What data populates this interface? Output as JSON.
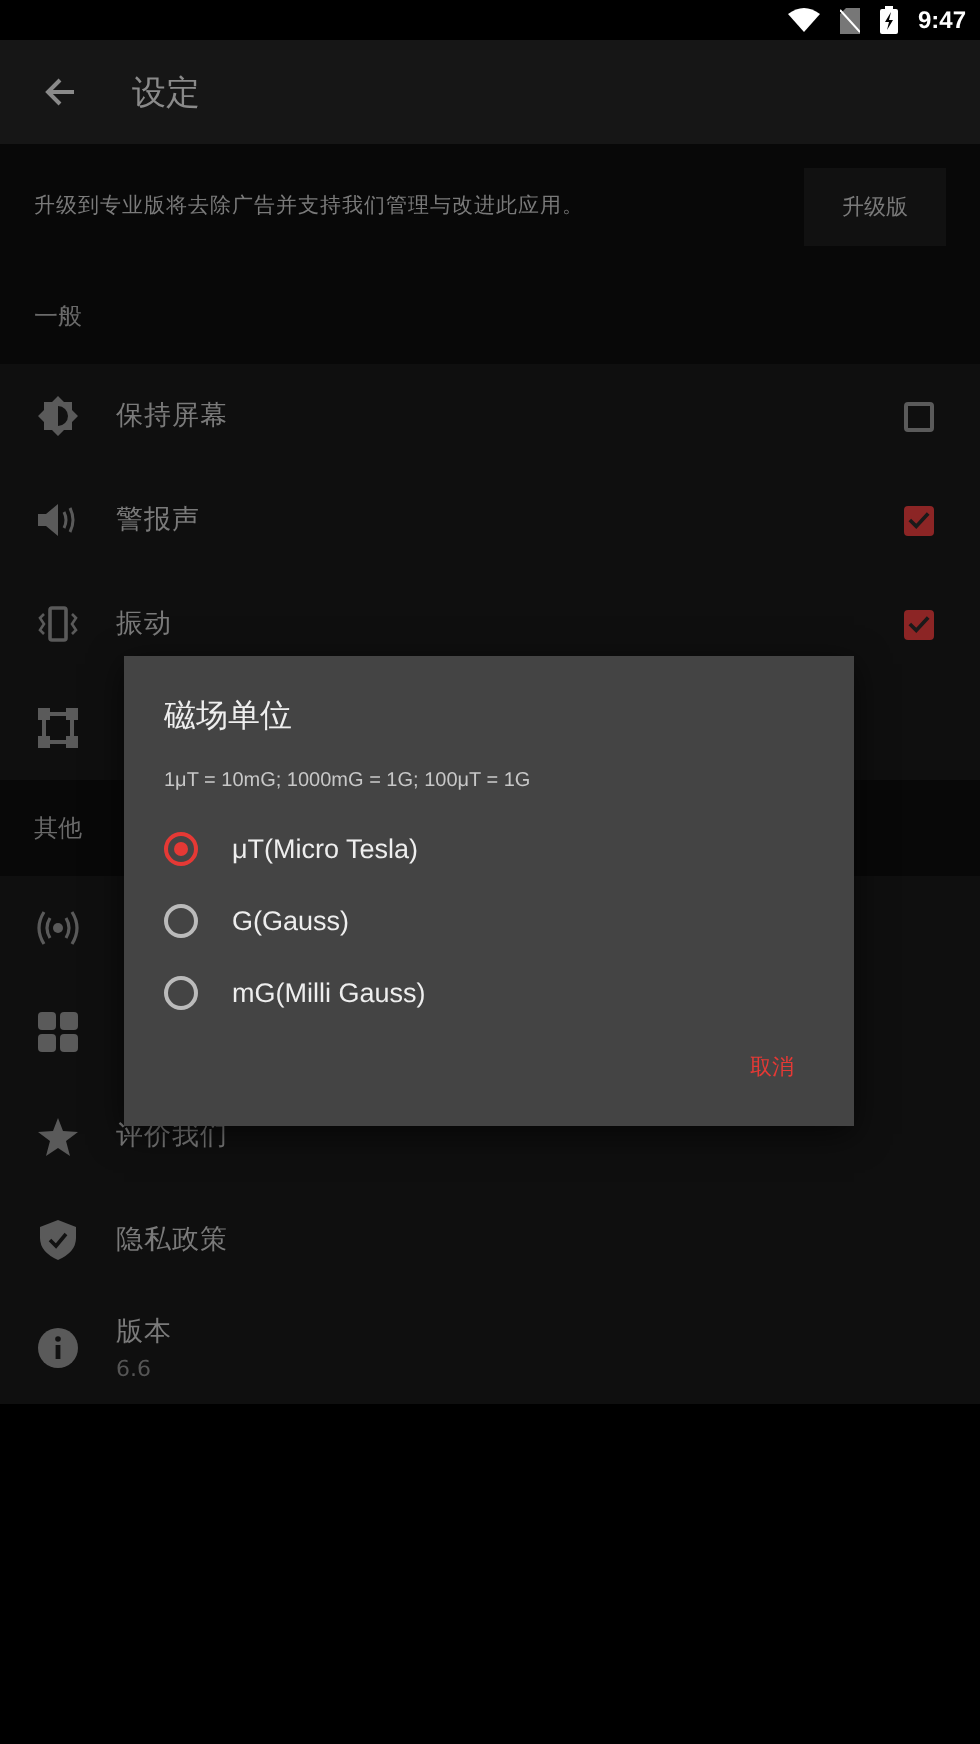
{
  "status_bar": {
    "time": "9:47"
  },
  "app_bar": {
    "title": "设定"
  },
  "upgrade": {
    "text": "升级到专业版将去除广告并支持我们管理与改进此应用。",
    "button": "升级版"
  },
  "sections": [
    {
      "header": "一般",
      "items": [
        {
          "kind": "checkbox",
          "label": "保持屏幕",
          "checked": false
        },
        {
          "kind": "checkbox",
          "label": "警报声",
          "checked": true
        },
        {
          "kind": "checkbox",
          "label": "振动",
          "checked": true
        },
        {
          "kind": "covered"
        }
      ]
    },
    {
      "header": "其他",
      "items": [
        {
          "kind": "covered"
        },
        {
          "kind": "covered"
        },
        {
          "kind": "plain",
          "label": "评价我们"
        },
        {
          "kind": "plain",
          "label": "隐私政策"
        },
        {
          "kind": "detail",
          "label": "版本",
          "detail": "6.6"
        }
      ]
    }
  ],
  "dialog": {
    "title": "磁场单位",
    "message": "1μT = 10mG; 1000mG = 1G; 100μT = 1G",
    "options": [
      {
        "label": "μT(Micro Tesla)",
        "selected": true
      },
      {
        "label": "G(Gauss)",
        "selected": false
      },
      {
        "label": "mG(Milli Gauss)",
        "selected": false
      }
    ],
    "cancel": "取消"
  }
}
